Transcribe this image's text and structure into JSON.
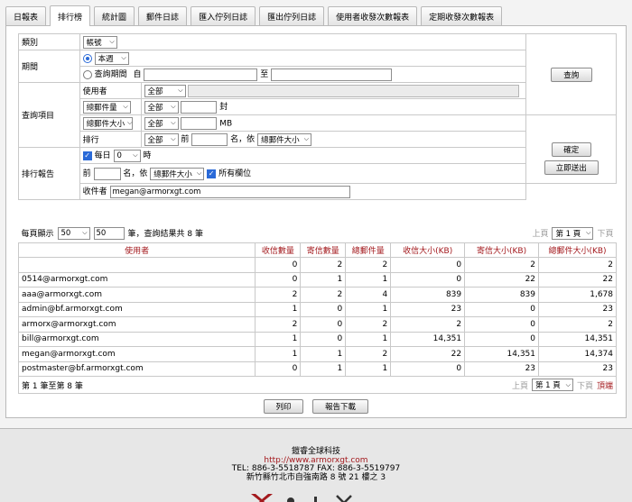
{
  "tabs": [
    "日報表",
    "排行榜",
    "統計圖",
    "郵件日誌",
    "匯入佇列日誌",
    "匯出佇列日誌",
    "使用者收發次數報表",
    "定期收發次數報表"
  ],
  "active_tab": 1,
  "form": {
    "category_label": "類別",
    "category_value": "帳號",
    "period_label": "期間",
    "period_option": "本週",
    "query_period_label": "查詢期間",
    "from_label": "自",
    "to_label": "至",
    "items_label": "查詢項目",
    "user_label": "使用者",
    "user_scope": "全部",
    "mail_count_label": "總郵件量",
    "mail_count_scope": "全部",
    "mail_count_unit": "封",
    "mail_size_label": "總郵件大小",
    "mail_size_scope": "全部",
    "mail_size_unit": "MB",
    "rank_label": "排行",
    "rank_scope": "全部",
    "rank_prefix": "前",
    "rank_name_by": "名，依",
    "rank_order": "總郵件大小",
    "query_button": "查詢",
    "report_label": "排行報告",
    "daily_label": "每日",
    "daily_hour": "0",
    "hour_unit": "時",
    "report_prefix": "前",
    "report_name_by": "名，依",
    "report_order": "總郵件大小",
    "all_fields_label": "所有欄位",
    "recipient_label": "收件者",
    "recipient_value": "megan@armorxgt.com",
    "confirm_button": "確定",
    "send_now_button": "立即送出"
  },
  "results": {
    "per_page_label": "每頁顯示",
    "per_page_value": "50",
    "per_page_input": "50",
    "summary": "筆，查詢結果共 8 筆",
    "prev_label": "上頁",
    "page_select": "第 1 頁",
    "next_label": "下頁",
    "top_label": "頂端",
    "range_text": "第 1 筆至第 8 筆",
    "columns": [
      "使用者",
      "收信數量",
      "寄信數量",
      "總郵件量",
      "收信大小(KB)",
      "寄信大小(KB)",
      "總郵件大小(KB)"
    ],
    "rows": [
      [
        "",
        "0",
        "2",
        "2",
        "0",
        "2",
        "2"
      ],
      [
        "0514@armorxgt.com",
        "0",
        "1",
        "1",
        "0",
        "22",
        "22"
      ],
      [
        "aaa@armorxgt.com",
        "2",
        "2",
        "4",
        "839",
        "839",
        "1,678"
      ],
      [
        "admin@bf.armorxgt.com",
        "1",
        "0",
        "1",
        "23",
        "0",
        "23"
      ],
      [
        "armorx@armorxgt.com",
        "2",
        "0",
        "2",
        "2",
        "0",
        "2"
      ],
      [
        "bill@armorxgt.com",
        "1",
        "0",
        "1",
        "14,351",
        "0",
        "14,351"
      ],
      [
        "megan@armorxgt.com",
        "1",
        "1",
        "2",
        "22",
        "14,351",
        "14,374"
      ],
      [
        "postmaster@bf.armorxgt.com",
        "0",
        "1",
        "1",
        "0",
        "23",
        "23"
      ]
    ],
    "print_button": "列印",
    "download_button": "報告下載"
  },
  "footer": {
    "company": "鎧睿全球科技",
    "url": "http://www.armorxgt.com",
    "contact": "TEL: 886-3-5518787  FAX: 886-3-5519797",
    "address": "新竹縣竹北市自強南路 8 號 21 樓之 3"
  },
  "colors": {
    "header_text": "#a3191d",
    "accent": "#2a6ad8",
    "footer_bg": "#e7e7e7"
  }
}
